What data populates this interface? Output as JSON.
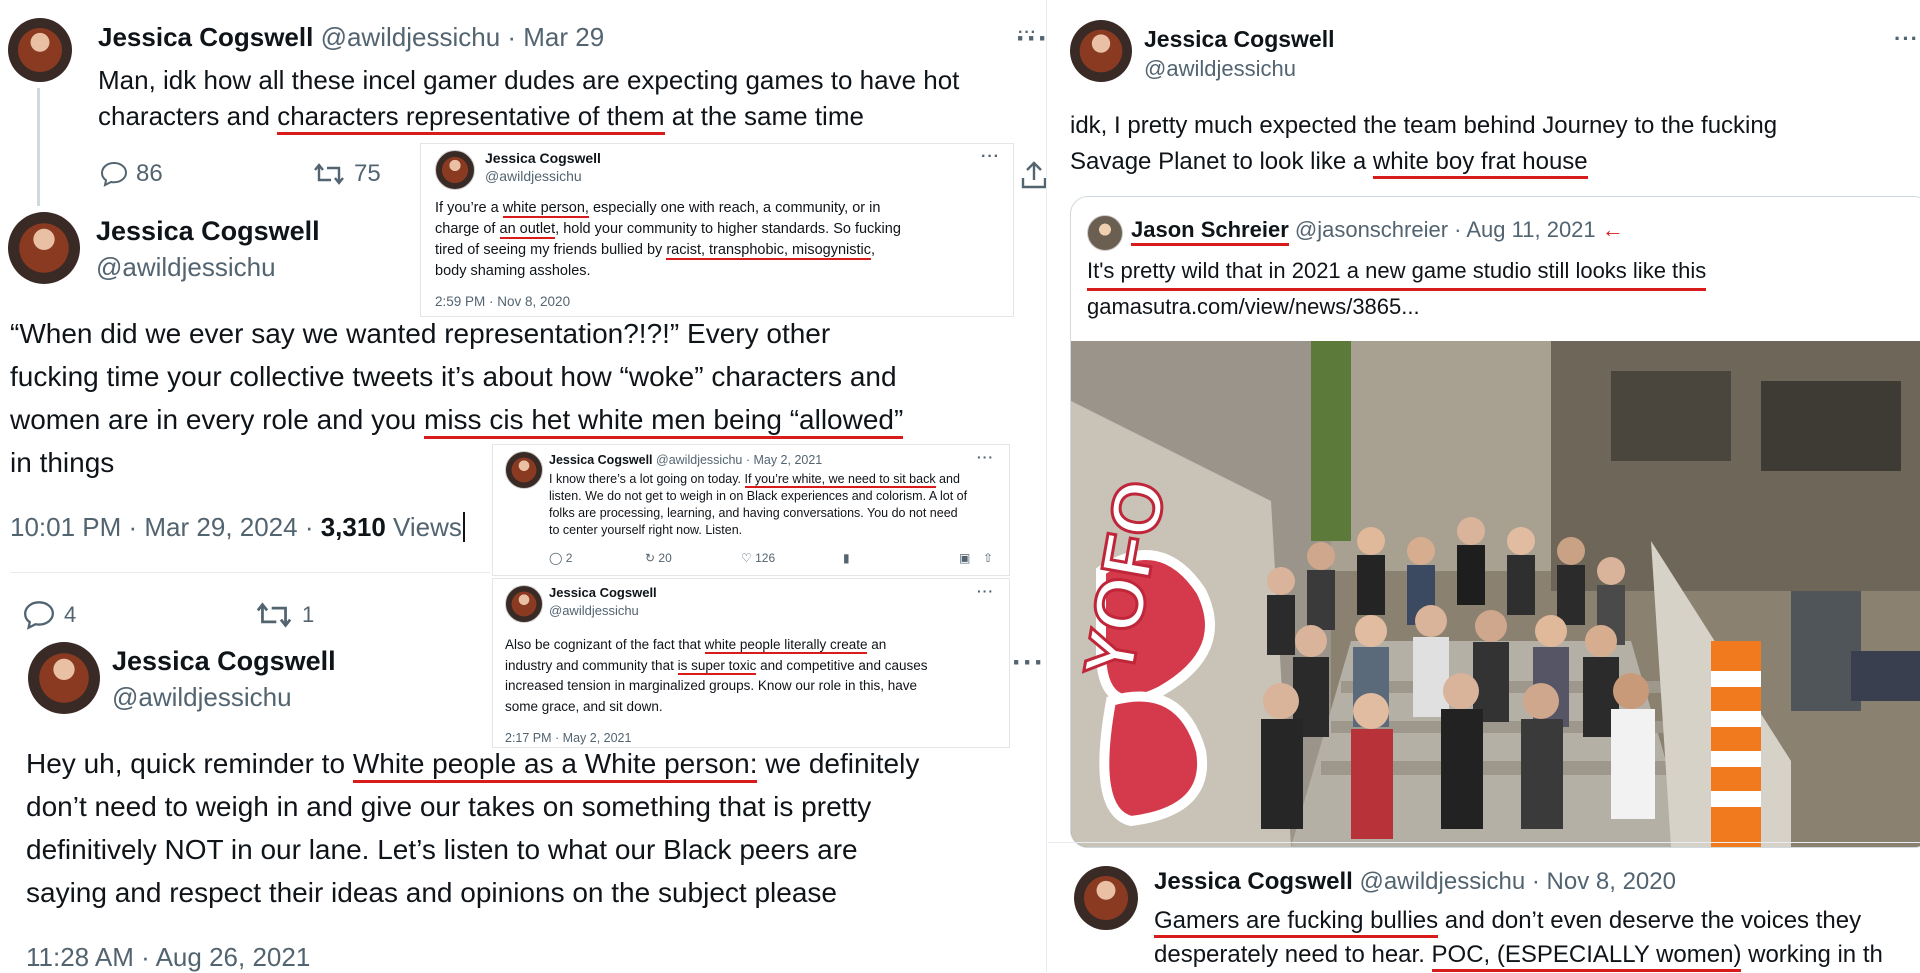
{
  "left": {
    "tweet1": {
      "name": "Jessica Cogswell",
      "handle": "@awildjessichu",
      "date": "· Mar 29",
      "text_a": "Man, idk how all these incel gamer dudes are expecting games to have hot",
      "text_b1": "characters and ",
      "text_b2": "characters representative of them",
      "text_b3": " at the same time",
      "replies": "86",
      "retweets": "75"
    },
    "tweet2": {
      "name": "Jessica Cogswell",
      "handle": "@awildjessichu",
      "line1": "“When did we ever say we wanted representation?!?!” Every other",
      "line2": "fucking time your collective tweets it’s about how “woke” characters and",
      "line3a": "women are in every role and you ",
      "line3b": "miss cis het white men being “allowed”",
      "line4": "in things",
      "timestamp": "10:01 PM · Mar 29, 2024 · ",
      "views_count": "3,310",
      "views_label": " Views",
      "replies": "4",
      "retweets": "1"
    },
    "tweet3": {
      "name": "Jessica Cogswell",
      "handle": "@awildjessichu",
      "line1a": "Hey uh, quick reminder to ",
      "line1b": "White people as a White person:",
      "line1c": " we definitely",
      "line2": "don’t need to weigh in and give our takes on something that is pretty",
      "line3": "definitively NOT in our lane. Let’s listen to what our Black peers are",
      "line4": "saying and respect their ideas and opinions on the subject please",
      "timestamp": "11:28 AM · Aug 26, 2021"
    }
  },
  "inset1": {
    "name": "Jessica Cogswell",
    "handle": "@awildjessichu",
    "l1a": "If you’re a ",
    "l1b": "white person,",
    "l1c": " especially one with reach, a community, or in",
    "l2a": "charge of ",
    "l2b": "an outlet",
    "l2c": ", hold your community to higher standards. So fucking",
    "l3a": "tired of seeing my friends bullied by ",
    "l3b": "racist, transphobic, misogynistic",
    "l3c": ",",
    "l4": "body shaming assholes.",
    "timestamp": "2:59 PM · Nov 8, 2020"
  },
  "inset2": {
    "name": "Jessica Cogswell",
    "handle": "@awildjessichu · May 2, 2021",
    "l1a": "I know there’s a lot going on today. ",
    "l1b": "If you’re white, we need to sit back",
    "l1c": " and",
    "l2": "listen. We do not get to weigh in on Black experiences and colorism. A lot of",
    "l3": "folks are processing, learning, and having conversations. You do not need",
    "l4": "to center yourself right now. Listen.",
    "replies": "2",
    "retweets": "20",
    "likes": "126"
  },
  "inset3": {
    "name": "Jessica Cogswell",
    "handle": "@awildjessichu",
    "l1a": "Also be cognizant of the fact that ",
    "l1b": "white people literally create",
    "l1c": " an",
    "l2a": "industry and community that ",
    "l2b": "is super toxic",
    "l2c": " and competitive and causes",
    "l3": "increased tension in marginalized groups. Know our role in this, have",
    "l4": "some grace, and sit down.",
    "timestamp": "2:17 PM · May 2, 2021"
  },
  "right": {
    "tweet1": {
      "name": "Jessica Cogswell",
      "handle": "@awildjessichu",
      "line1": "idk, I pretty much expected the team behind Journey to the fucking",
      "line2a": "Savage Planet to look like a ",
      "line2b": "white boy frat house"
    },
    "quote": {
      "name": "Jason Schreier",
      "handle": "@jasonschreier · Aug 11, 2021",
      "arrow": "←",
      "line1": "It's pretty wild that in 2021 a new game studio still looks like this",
      "link": "gamasutra.com/view/news/3865..."
    },
    "tweet2": {
      "name": "Jessica Cogswell",
      "handle": "@awildjessichu · Nov 8, 2020",
      "line1a": "Gamers are fucking bullies",
      "line1b": " and don’t even deserve the voices they",
      "line2a": "desperately need to hear. ",
      "line2b": "POC, (ESPECIALLY women)",
      "line2c": " working in th"
    }
  },
  "photo": {
    "graffiti": "YOFO"
  },
  "more_label": "···",
  "colors": {
    "underline": "#d81b1b",
    "muted": "#536471",
    "text": "#0f1419",
    "divider": "#cfd9de"
  }
}
